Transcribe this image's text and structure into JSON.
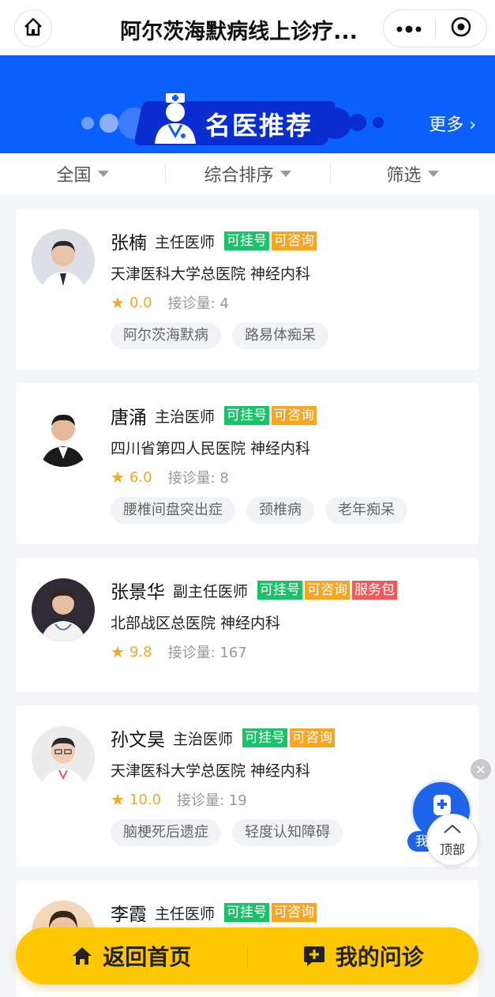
{
  "navbar": {
    "title": "阿尔茨海默病线上诊疗...",
    "home_icon": "home-icon",
    "more_icon": "more-dots-icon",
    "close_icon": "target-circle-icon"
  },
  "banner": {
    "title": "名医推荐",
    "more": "更多 ›",
    "accent": "#0b5ffd"
  },
  "filters": [
    {
      "label": "全国"
    },
    {
      "label": "综合排序"
    },
    {
      "label": "筛选"
    }
  ],
  "doctors": [
    {
      "name": "张楠",
      "title": "主任医师",
      "tags": [
        "可挂号",
        "可咨询"
      ],
      "hospital": "天津医科大学总医院  神经内科",
      "score": "0.0",
      "consult_label": "接诊量: 4",
      "chips": [
        "阿尔茨海默病",
        "路易体痴呆"
      ]
    },
    {
      "name": "唐涌",
      "title": "主治医师",
      "tags": [
        "可挂号",
        "可咨询"
      ],
      "hospital": "四川省第四人民医院  神经内科",
      "score": "6.0",
      "consult_label": "接诊量: 8",
      "chips": [
        "腰椎间盘突出症",
        "颈椎病",
        "老年痴呆"
      ]
    },
    {
      "name": "张景华",
      "title": "副主任医师",
      "tags": [
        "可挂号",
        "可咨询",
        "服务包"
      ],
      "hospital": "北部战区总医院  神经内科",
      "score": "9.8",
      "consult_label": "接诊量: 167",
      "chips": []
    },
    {
      "name": "孙文昊",
      "title": "主治医师",
      "tags": [
        "可挂号",
        "可咨询"
      ],
      "hospital": "天津医科大学总医院  神经内科",
      "score": "10.0",
      "consult_label": "接诊量: 19",
      "chips": [
        "脑梗死后遗症",
        "轻度认知障碍"
      ]
    },
    {
      "name": "李霞",
      "title": "主任医师",
      "tags": [
        "可挂号",
        "可咨询"
      ],
      "hospital": "",
      "score": "",
      "consult_label": "",
      "chips": []
    }
  ],
  "floating": {
    "ask_label": "我",
    "top_label": "顶部"
  },
  "bottom": {
    "home_label": "返回首页",
    "consult_label": "我的问诊",
    "color": "#ffc700"
  }
}
